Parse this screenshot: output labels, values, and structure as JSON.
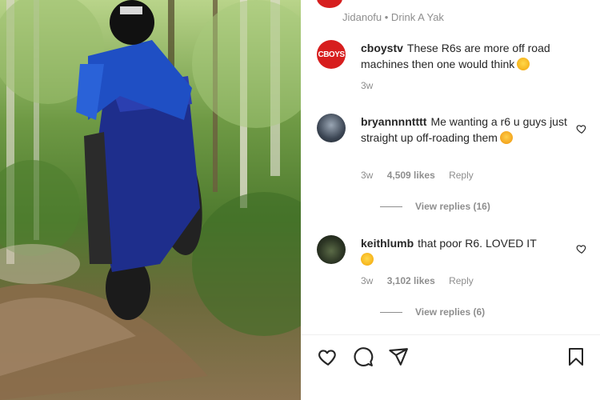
{
  "post": {
    "image_alt": "Rider in blue doing a wheelie on a blue motorcycle on a forest dirt trail",
    "top_line": "Jidanofu • Drink A Yak"
  },
  "caption": {
    "avatar_text": "CBOYS",
    "username": "cboystv",
    "text": "These R6s are more off road machines then one would think",
    "emoji": "laughing-emoji",
    "time": "3w"
  },
  "comments": [
    {
      "username": "bryannnntttt",
      "text": "Me wanting a r6 u guys just straight up off-roading them",
      "emoji": "crying-emoji",
      "time": "3w",
      "likes": "4,509 likes",
      "reply_label": "Reply",
      "view_replies": "View replies (16)"
    },
    {
      "username": "keithlumb",
      "text": "that poor R6. LOVED IT",
      "emoji": "rofl-emoji",
      "time": "3w",
      "likes": "3,102 likes",
      "reply_label": "Reply",
      "view_replies": "View replies (6)"
    }
  ],
  "colors": {
    "brand_red": "#d71e1e",
    "text_primary": "#262626",
    "text_secondary": "#8e8e8e"
  },
  "actions": [
    "like-icon",
    "comment-icon",
    "share-icon",
    "save-icon"
  ]
}
